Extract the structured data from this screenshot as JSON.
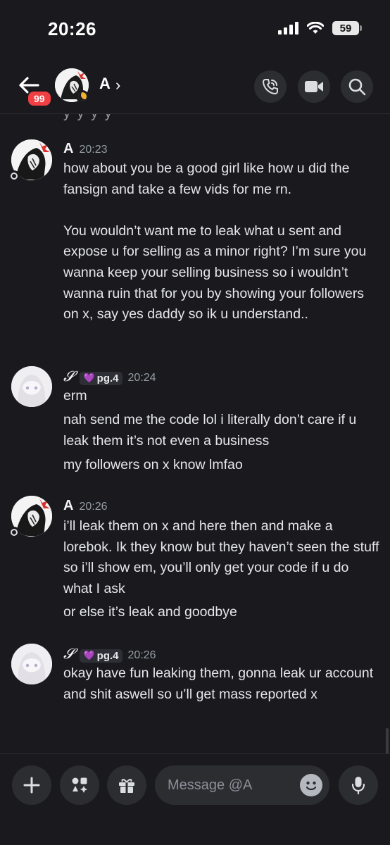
{
  "status_bar": {
    "time": "20:26",
    "battery": "59"
  },
  "header": {
    "unread_count": "99",
    "contact_name": "A",
    "chevron": "›"
  },
  "chat": {
    "prev_tail": "y y y y",
    "messages": [
      {
        "author": "A",
        "time": "20:23",
        "lines": [
          "how about you be a good girl like how u did the fansign and take a few vids for me rn.\n\nYou wouldn’t want me to leak what u sent and expose u for selling as a minor right? I’m sure you wanna keep your selling business so i wouldn’t wanna ruin that for you by showing your followers on x, say yes daddy so ik u understand.."
        ]
      },
      {
        "author": "𝓢",
        "tag": "pg.4",
        "time": "20:24",
        "lines": [
          "erm",
          "nah send me the code lol i literally don’t care if u leak them it’s not even a business",
          "my followers on x know lmfao"
        ]
      },
      {
        "author": "A",
        "time": "20:26",
        "lines": [
          "i’ll leak them on x and here then and make a lorebok. Ik they know but they haven’t seen the stuff so i’ll show em, you’ll only get your code if u do what I ask",
          "or else it’s leak and goodbye"
        ]
      },
      {
        "author": "𝓢",
        "tag": "pg.4",
        "time": "20:26",
        "lines": [
          "okay have fun leaking them, gonna leak ur account and shit aswell so u’ll get mass reported x"
        ]
      }
    ]
  },
  "composer": {
    "placeholder": "Message @A"
  },
  "icons": {
    "back": "back-arrow-icon",
    "call": "phone-icon",
    "video": "video-camera-icon",
    "search": "search-icon",
    "add": "plus-icon",
    "apps": "apps-icon",
    "gift": "gift-icon",
    "emoji": "emoji-icon",
    "mic": "microphone-icon"
  }
}
